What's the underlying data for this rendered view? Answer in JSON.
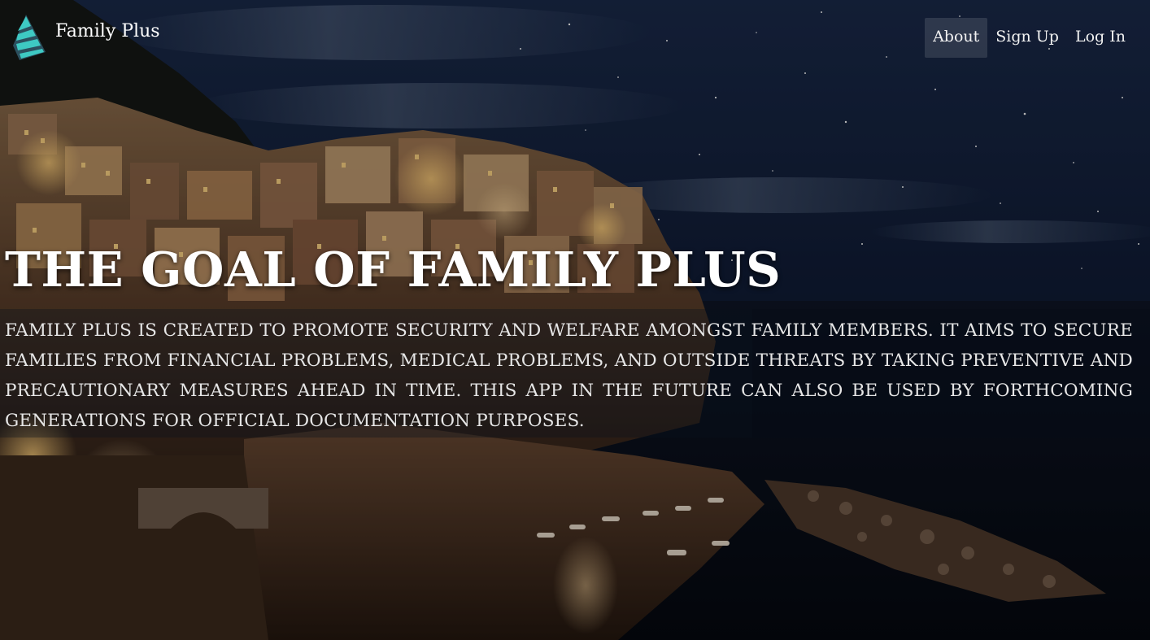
{
  "brand": {
    "name": "Family Plus",
    "logo_icon": "striped-leaf-logo",
    "accent": "#3ec9c3"
  },
  "nav": {
    "items": [
      {
        "label": "About",
        "active": true
      },
      {
        "label": "Sign Up",
        "active": false
      },
      {
        "label": "Log In",
        "active": false
      }
    ]
  },
  "hero": {
    "title": "THE GOAL OF FAMILY PLUS",
    "description": "Family Plus is created to promote security and welfare amongst family members. It aims to secure families from financial problems, medical problems, and outside threats by taking preventive and precautionary measures ahead in time. This app in the future can also be used by forthcoming generations for official documentation purposes."
  },
  "background": {
    "scene": "coastal village on a hillside at night under a starry sky",
    "sky_color": "#0f1b33",
    "light_color": "#f2b35a"
  }
}
